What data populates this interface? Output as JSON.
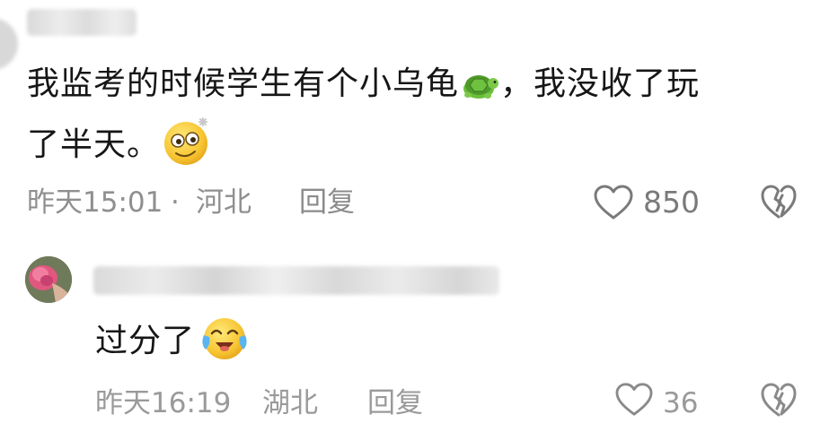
{
  "comment": {
    "author_redacted": true,
    "text_line1_before_emoji": "我监考的时候学生有个小乌龟",
    "text_line1_after_emoji": "，我没收了玩",
    "text_line2": "了半天。",
    "emoji_1": "turtle-emoji",
    "emoji_2": "dazed-face-emoji",
    "time": "昨天15:01",
    "separator": "·",
    "location": "河北",
    "reply_label": "回复",
    "like_count": "850"
  },
  "reply": {
    "author_redacted": true,
    "text": "过分了",
    "emoji": "crying-laughing-face-emoji",
    "time": "昨天16:19",
    "location": "湖北",
    "reply_label": "回复",
    "like_count": "36"
  },
  "colors": {
    "text": "#161616",
    "meta": "#8f8f8f",
    "background": "#ffffff"
  }
}
